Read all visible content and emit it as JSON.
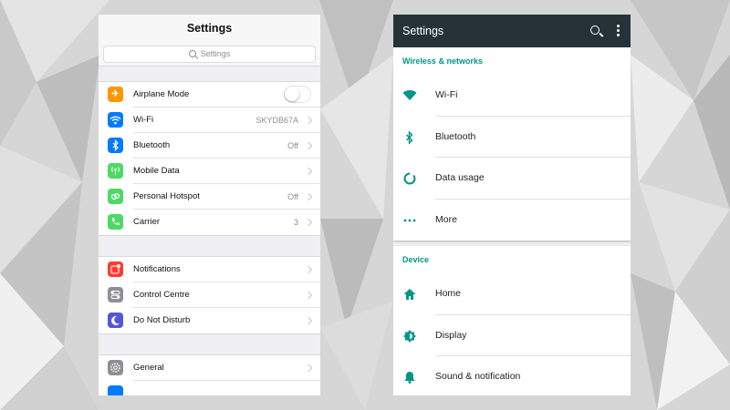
{
  "ios": {
    "title": "Settings",
    "search_placeholder": "Settings",
    "groups": [
      [
        {
          "label": "Airplane Mode",
          "value": "",
          "icon": "airplane-icon",
          "color": "#ff9500",
          "toggle": true
        },
        {
          "label": "Wi-Fi",
          "value": "SKYDB67A",
          "icon": "wifi-icon",
          "color": "#007aff"
        },
        {
          "label": "Bluetooth",
          "value": "Off",
          "icon": "bluetooth-icon",
          "color": "#007aff"
        },
        {
          "label": "Mobile Data",
          "value": "",
          "icon": "antenna-icon",
          "color": "#4cd964"
        },
        {
          "label": "Personal Hotspot",
          "value": "Off",
          "icon": "hotspot-icon",
          "color": "#4cd964"
        },
        {
          "label": "Carrier",
          "value": "3",
          "icon": "phone-icon",
          "color": "#4cd964"
        }
      ],
      [
        {
          "label": "Notifications",
          "value": "",
          "icon": "notifications-icon",
          "color": "#ff3b30"
        },
        {
          "label": "Control Centre",
          "value": "",
          "icon": "control-centre-icon",
          "color": "#8e8e93"
        },
        {
          "label": "Do Not Disturb",
          "value": "",
          "icon": "moon-icon",
          "color": "#5856d6"
        }
      ],
      [
        {
          "label": "General",
          "value": "",
          "icon": "gear-icon",
          "color": "#8e8e93"
        },
        {
          "label": "",
          "value": "",
          "icon": "display-icon",
          "color": "#007aff"
        }
      ]
    ]
  },
  "android": {
    "title": "Settings",
    "sections": [
      {
        "title": "Wireless & networks",
        "items": [
          {
            "label": "Wi-Fi",
            "icon": "wifi-icon"
          },
          {
            "label": "Bluetooth",
            "icon": "bluetooth-icon"
          },
          {
            "label": "Data usage",
            "icon": "data-usage-icon"
          },
          {
            "label": "More",
            "icon": "more-dots-icon"
          }
        ]
      },
      {
        "title": "Device",
        "items": [
          {
            "label": "Home",
            "icon": "home-icon"
          },
          {
            "label": "Display",
            "icon": "brightness-icon"
          },
          {
            "label": "Sound & notification",
            "icon": "bell-icon"
          }
        ]
      }
    ],
    "accent": "#009688",
    "toolbar_color": "#263238"
  }
}
